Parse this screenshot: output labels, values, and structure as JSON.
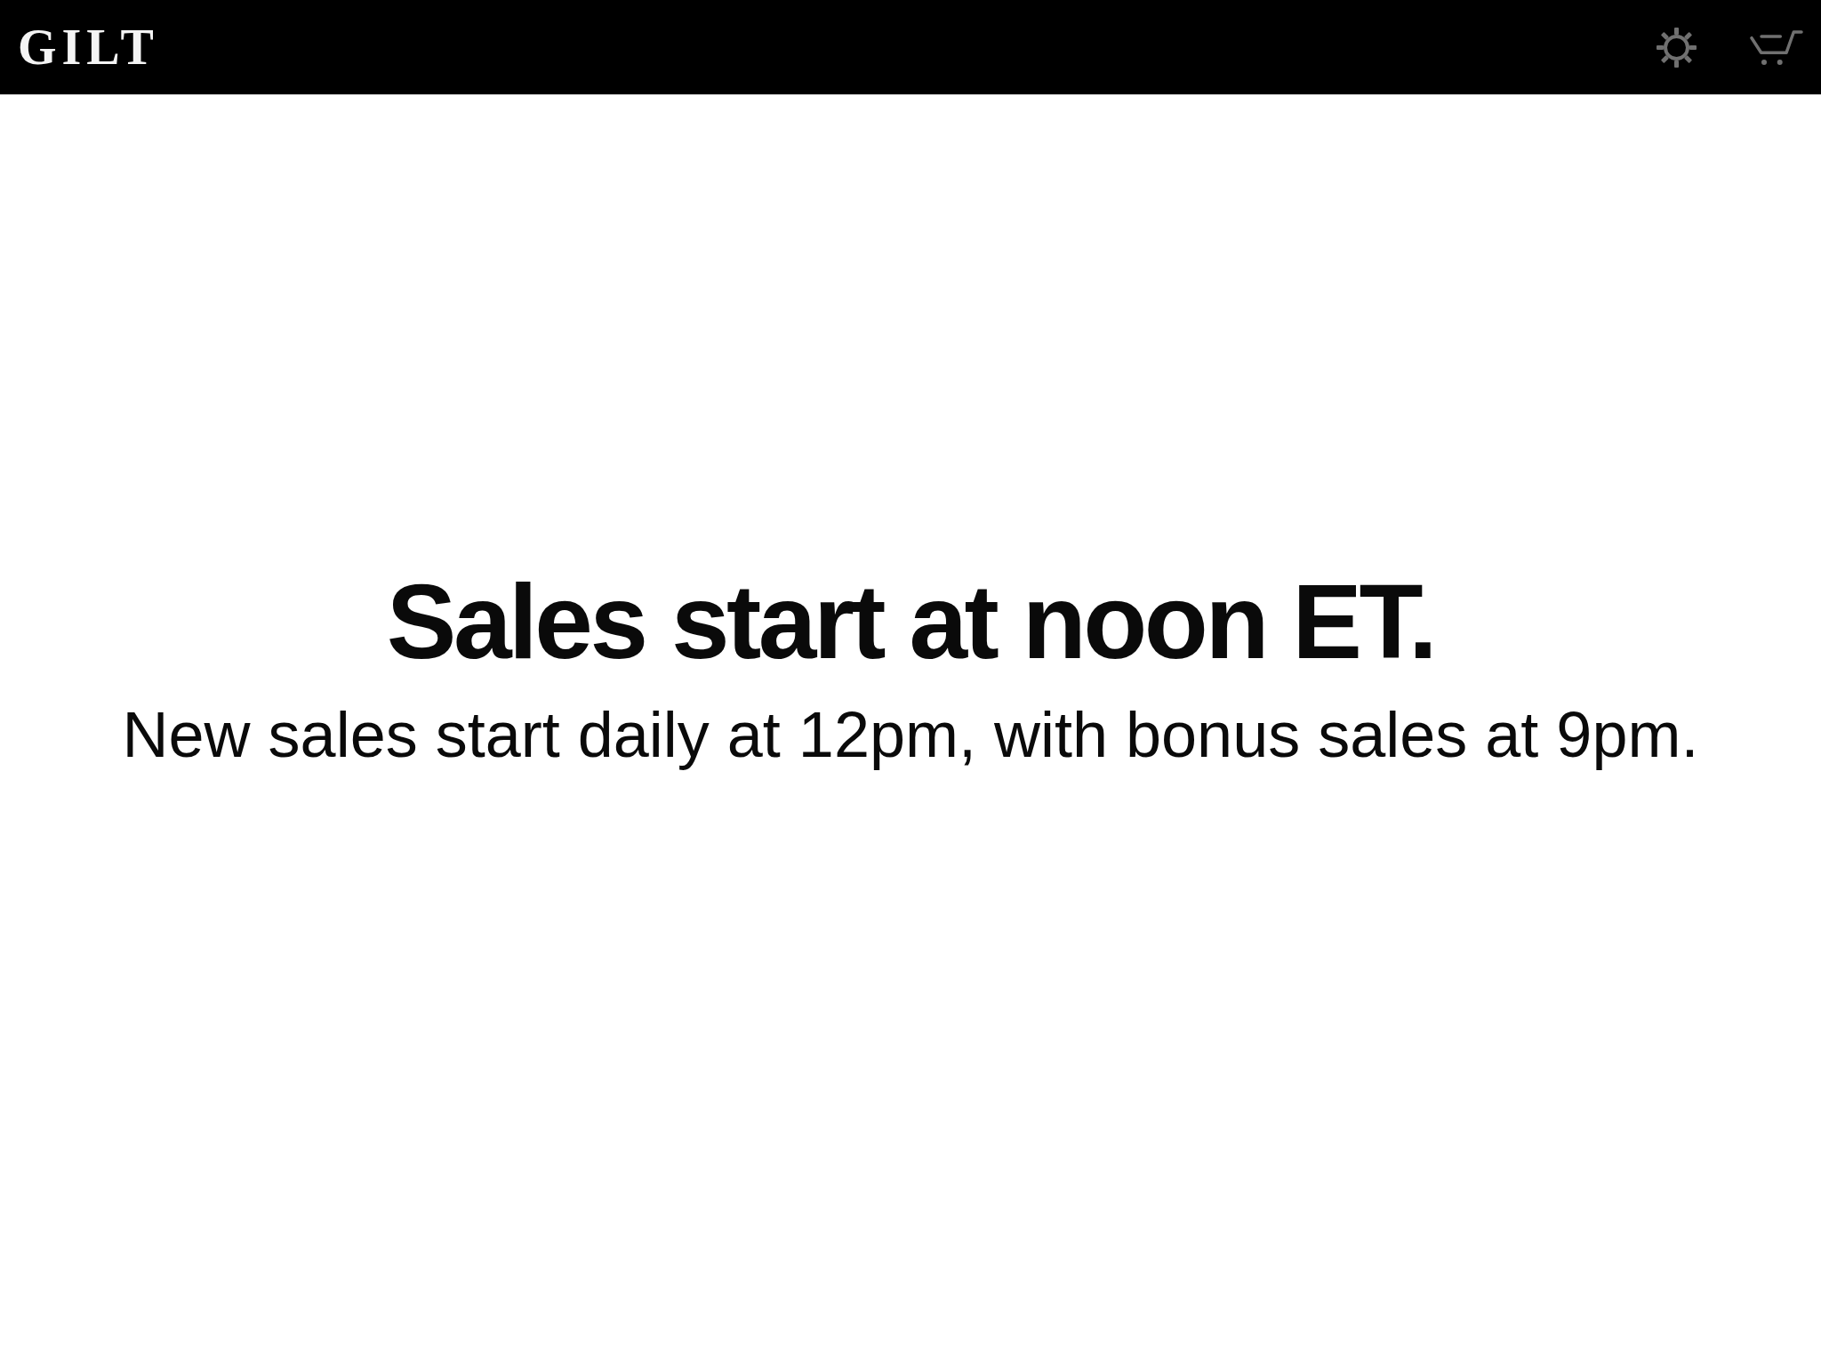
{
  "header": {
    "logo": "GILT"
  },
  "message": {
    "title": "Sales start at noon ET.",
    "subtitle": "New sales start daily at 12pm, with bonus sales at 9pm."
  }
}
